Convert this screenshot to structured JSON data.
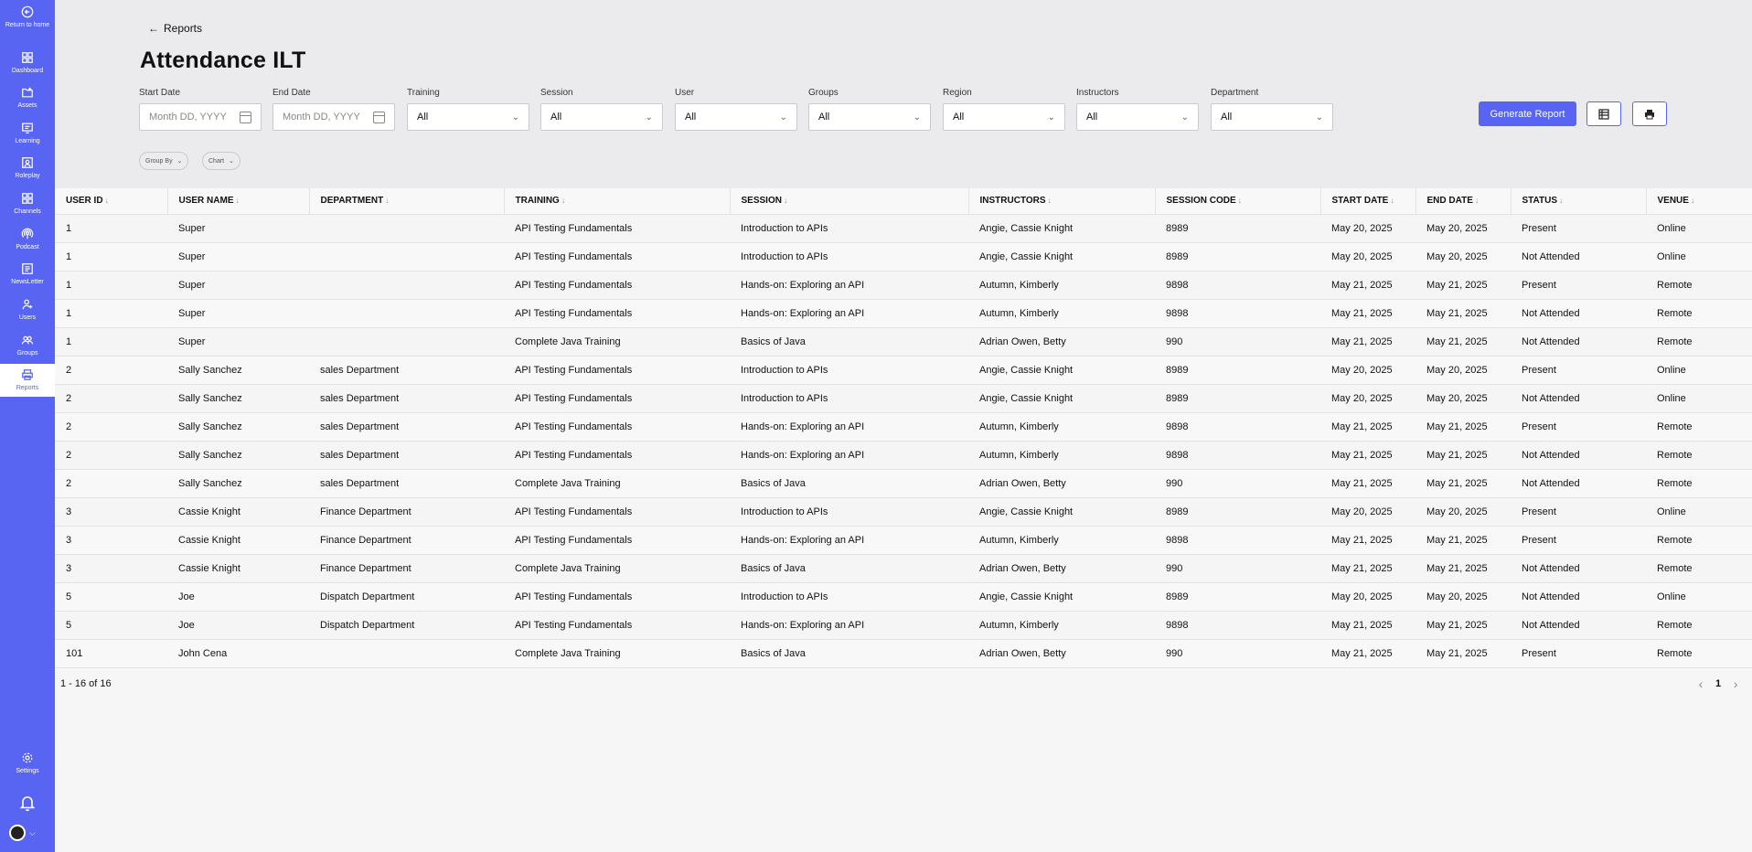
{
  "sidebar": {
    "items": [
      {
        "label": "Return to home",
        "icon": "return-home-icon"
      },
      {
        "label": "Dashboard",
        "icon": "dashboard-icon"
      },
      {
        "label": "Assets",
        "icon": "assets-icon"
      },
      {
        "label": "Learning",
        "icon": "learning-icon"
      },
      {
        "label": "Roleplay",
        "icon": "roleplay-icon"
      },
      {
        "label": "Channels",
        "icon": "channels-icon"
      },
      {
        "label": "Podcast",
        "icon": "podcast-icon"
      },
      {
        "label": "NewsLetter",
        "icon": "newsletter-icon"
      },
      {
        "label": "Users",
        "icon": "users-icon"
      },
      {
        "label": "Groups",
        "icon": "groups-icon"
      },
      {
        "label": "Reports",
        "icon": "reports-icon"
      },
      {
        "label": "Settings",
        "icon": "settings-icon"
      }
    ],
    "active": "Reports"
  },
  "header": {
    "back_label": "Reports",
    "title": "Attendance ILT"
  },
  "filters": {
    "start_date": {
      "label": "Start Date",
      "placeholder": "Month DD, YYYY"
    },
    "end_date": {
      "label": "End Date",
      "placeholder": "Month DD, YYYY"
    },
    "training": {
      "label": "Training",
      "value": "All"
    },
    "session": {
      "label": "Session",
      "value": "All"
    },
    "user": {
      "label": "User",
      "value": "All"
    },
    "groups": {
      "label": "Groups",
      "value": "All"
    },
    "region": {
      "label": "Region",
      "value": "All"
    },
    "instructors": {
      "label": "Instructors",
      "value": "All"
    },
    "department": {
      "label": "Department",
      "value": "All"
    }
  },
  "actions": {
    "generate_label": "Generate Report",
    "export_icon": "spreadsheet-icon",
    "print_icon": "printer-icon"
  },
  "pills": {
    "group_by": "Group By",
    "chart": "Chart"
  },
  "table": {
    "headers": [
      "USER ID",
      "USER NAME",
      "DEPARTMENT",
      "TRAINING",
      "SESSION",
      "INSTRUCTORS",
      "SESSION CODE",
      "START DATE",
      "END DATE",
      "STATUS",
      "VENUE"
    ],
    "rows": [
      [
        "1",
        "Super",
        "",
        "API Testing Fundamentals",
        "Introduction to APIs",
        "Angie, Cassie Knight",
        "8989",
        "May 20, 2025",
        "May 20, 2025",
        "Present",
        "Online"
      ],
      [
        "1",
        "Super",
        "",
        "API Testing Fundamentals",
        "Introduction to APIs",
        "Angie, Cassie Knight",
        "8989",
        "May 20, 2025",
        "May 20, 2025",
        "Not Attended",
        "Online"
      ],
      [
        "1",
        "Super",
        "",
        "API Testing Fundamentals",
        "Hands-on: Exploring an API",
        "Autumn, Kimberly",
        "9898",
        "May 21, 2025",
        "May 21, 2025",
        "Present",
        "Remote"
      ],
      [
        "1",
        "Super",
        "",
        "API Testing Fundamentals",
        "Hands-on: Exploring an API",
        "Autumn, Kimberly",
        "9898",
        "May 21, 2025",
        "May 21, 2025",
        "Not Attended",
        "Remote"
      ],
      [
        "1",
        "Super",
        "",
        "Complete Java Training",
        "Basics of Java",
        "Adrian Owen, Betty",
        "990",
        "May 21, 2025",
        "May 21, 2025",
        "Not Attended",
        "Remote"
      ],
      [
        "2",
        "Sally Sanchez",
        "sales Department",
        "API Testing Fundamentals",
        "Introduction to APIs",
        "Angie, Cassie Knight",
        "8989",
        "May 20, 2025",
        "May 20, 2025",
        "Present",
        "Online"
      ],
      [
        "2",
        "Sally Sanchez",
        "sales Department",
        "API Testing Fundamentals",
        "Introduction to APIs",
        "Angie, Cassie Knight",
        "8989",
        "May 20, 2025",
        "May 20, 2025",
        "Not Attended",
        "Online"
      ],
      [
        "2",
        "Sally Sanchez",
        "sales Department",
        "API Testing Fundamentals",
        "Hands-on: Exploring an API",
        "Autumn, Kimberly",
        "9898",
        "May 21, 2025",
        "May 21, 2025",
        "Present",
        "Remote"
      ],
      [
        "2",
        "Sally Sanchez",
        "sales Department",
        "API Testing Fundamentals",
        "Hands-on: Exploring an API",
        "Autumn, Kimberly",
        "9898",
        "May 21, 2025",
        "May 21, 2025",
        "Not Attended",
        "Remote"
      ],
      [
        "2",
        "Sally Sanchez",
        "sales Department",
        "Complete Java Training",
        "Basics of Java",
        "Adrian Owen, Betty",
        "990",
        "May 21, 2025",
        "May 21, 2025",
        "Not Attended",
        "Remote"
      ],
      [
        "3",
        "Cassie Knight",
        "Finance Department",
        "API Testing Fundamentals",
        "Introduction to APIs",
        "Angie, Cassie Knight",
        "8989",
        "May 20, 2025",
        "May 20, 2025",
        "Present",
        "Online"
      ],
      [
        "3",
        "Cassie Knight",
        "Finance Department",
        "API Testing Fundamentals",
        "Hands-on: Exploring an API",
        "Autumn, Kimberly",
        "9898",
        "May 21, 2025",
        "May 21, 2025",
        "Present",
        "Remote"
      ],
      [
        "3",
        "Cassie Knight",
        "Finance Department",
        "Complete Java Training",
        "Basics of Java",
        "Adrian Owen, Betty",
        "990",
        "May 21, 2025",
        "May 21, 2025",
        "Not Attended",
        "Remote"
      ],
      [
        "5",
        "Joe",
        "Dispatch Department",
        "API Testing Fundamentals",
        "Introduction to APIs",
        "Angie, Cassie Knight",
        "8989",
        "May 20, 2025",
        "May 20, 2025",
        "Not Attended",
        "Online"
      ],
      [
        "5",
        "Joe",
        "Dispatch Department",
        "API Testing Fundamentals",
        "Hands-on: Exploring an API",
        "Autumn, Kimberly",
        "9898",
        "May 21, 2025",
        "May 21, 2025",
        "Not Attended",
        "Remote"
      ],
      [
        "101",
        "John Cena",
        "",
        "Complete Java Training",
        "Basics of Java",
        "Adrian Owen, Betty",
        "990",
        "May 21, 2025",
        "May 21, 2025",
        "Present",
        "Remote"
      ]
    ]
  },
  "pagination": {
    "summary": "1 - 16 of 16",
    "current_page": "1"
  },
  "colors": {
    "accent": "#5865f2",
    "header_bg": "#ebebee"
  }
}
